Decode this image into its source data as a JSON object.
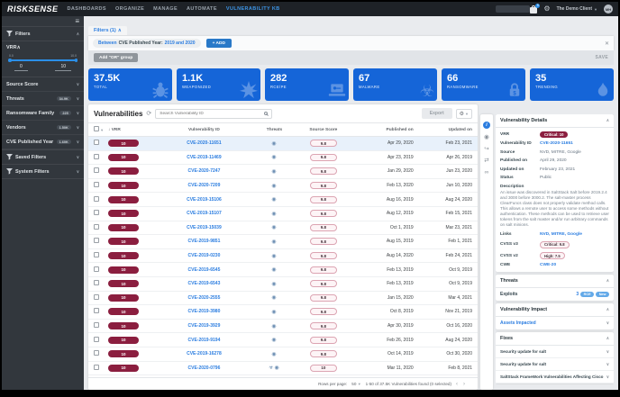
{
  "icon_glyphs": {
    "target-threat-icon": "◉",
    "malware-threat-icon": "☣"
  },
  "nav": {
    "logo": "RISKSENSE",
    "items": [
      {
        "label": "DASHBOARDS"
      },
      {
        "label": "ORGANIZE"
      },
      {
        "label": "MANAGE"
      },
      {
        "label": "AUTOMATE"
      },
      {
        "label": "VULNERABILITY KB",
        "active": true
      }
    ],
    "cart_badge": "5",
    "client": "The Demo Client",
    "avatar": "MH"
  },
  "sidebar": {
    "filters_title": "Filters",
    "vrr": {
      "label": "VRR",
      "min": "0.0",
      "max": "10.0",
      "from": "0",
      "to": "10"
    },
    "facets": [
      {
        "label": "Source Score",
        "count": ""
      },
      {
        "label": "Threats",
        "count": "34.9K"
      },
      {
        "label": "Ransomware Family",
        "count": "225"
      },
      {
        "label": "Vendors",
        "count": "1.50K"
      },
      {
        "label": "CVE Published Year",
        "count": "1.60K"
      }
    ],
    "saved_filters": "Saved Filters",
    "system_filters": "System Filters"
  },
  "filters": {
    "tab": "Filters (1)",
    "chip": {
      "operator": "Between",
      "field": "CVE Published Year:",
      "value": "2019 and 2020"
    },
    "add": "+ ADD",
    "or_group": "Add \"OR\" group",
    "save": "SAVE"
  },
  "stats": [
    {
      "value": "37.5K",
      "label": "TOTAL"
    },
    {
      "value": "1.1K",
      "label": "WEAPONIZED"
    },
    {
      "value": "282",
      "label": "RCE/PE"
    },
    {
      "value": "67",
      "label": "MALWARE"
    },
    {
      "value": "66",
      "label": "RANSOMWARE"
    },
    {
      "value": "35",
      "label": "TRENDING"
    }
  ],
  "table": {
    "title": "Vulnerabilities",
    "search_placeholder": "Search Vulnerability ID",
    "export": "Export",
    "columns": {
      "vrr": "VRR",
      "id": "Vulnerability ID",
      "threats": "Threats",
      "score": "Source Score",
      "published": "Published on",
      "updated": "Updated on"
    },
    "rows": [
      {
        "vrr": "10",
        "id": "CVE-2020-11651",
        "threats": [
          "target-threat-icon"
        ],
        "score": "9.8",
        "published": "Apr 29, 2020",
        "updated": "Feb 23, 2021",
        "selected": true
      },
      {
        "vrr": "10",
        "id": "CVE-2019-11469",
        "threats": [
          "target-threat-icon"
        ],
        "score": "9.8",
        "published": "Apr 23, 2019",
        "updated": "Apr 26, 2019"
      },
      {
        "vrr": "10",
        "id": "CVE-2020-7247",
        "threats": [
          "target-threat-icon"
        ],
        "score": "9.8",
        "published": "Jan 29, 2020",
        "updated": "Jun 23, 2020"
      },
      {
        "vrr": "10",
        "id": "CVE-2020-7209",
        "threats": [
          "target-threat-icon"
        ],
        "score": "9.8",
        "published": "Feb 13, 2020",
        "updated": "Jun 10, 2020"
      },
      {
        "vrr": "10",
        "id": "CVE-2019-15106",
        "threats": [
          "target-threat-icon"
        ],
        "score": "9.8",
        "published": "Aug 16, 2019",
        "updated": "Aug 24, 2020"
      },
      {
        "vrr": "10",
        "id": "CVE-2019-15107",
        "threats": [
          "target-threat-icon"
        ],
        "score": "9.8",
        "published": "Aug 12, 2019",
        "updated": "Feb 15, 2021"
      },
      {
        "vrr": "10",
        "id": "CVE-2019-15039",
        "threats": [
          "target-threat-icon"
        ],
        "score": "9.8",
        "published": "Oct 1, 2019",
        "updated": "Mar 23, 2021"
      },
      {
        "vrr": "10",
        "id": "CVE-2019-9851",
        "threats": [
          "target-threat-icon"
        ],
        "score": "9.8",
        "published": "Aug 15, 2019",
        "updated": "Feb 1, 2021"
      },
      {
        "vrr": "10",
        "id": "CVE-2019-0230",
        "threats": [
          "target-threat-icon"
        ],
        "score": "9.8",
        "published": "Aug 14, 2020",
        "updated": "Feb 24, 2021"
      },
      {
        "vrr": "10",
        "id": "CVE-2019-6545",
        "threats": [
          "target-threat-icon"
        ],
        "score": "9.8",
        "published": "Feb 13, 2019",
        "updated": "Oct 9, 2019"
      },
      {
        "vrr": "10",
        "id": "CVE-2019-6543",
        "threats": [
          "target-threat-icon"
        ],
        "score": "9.8",
        "published": "Feb 13, 2019",
        "updated": "Oct 9, 2019"
      },
      {
        "vrr": "10",
        "id": "CVE-2020-2555",
        "threats": [
          "target-threat-icon"
        ],
        "score": "9.8",
        "published": "Jan 15, 2020",
        "updated": "Mar 4, 2021"
      },
      {
        "vrr": "10",
        "id": "CVE-2019-3980",
        "threats": [
          "target-threat-icon"
        ],
        "score": "9.8",
        "published": "Oct 8, 2019",
        "updated": "Nov 21, 2019"
      },
      {
        "vrr": "10",
        "id": "CVE-2019-3929",
        "threats": [
          "target-threat-icon"
        ],
        "score": "9.8",
        "published": "Apr 30, 2019",
        "updated": "Oct 16, 2020"
      },
      {
        "vrr": "10",
        "id": "CVE-2019-9194",
        "threats": [
          "target-threat-icon"
        ],
        "score": "9.8",
        "published": "Feb 26, 2019",
        "updated": "Aug 24, 2020"
      },
      {
        "vrr": "10",
        "id": "CVE-2019-16278",
        "threats": [
          "target-threat-icon"
        ],
        "score": "9.8",
        "published": "Oct 14, 2019",
        "updated": "Oct 30, 2020"
      },
      {
        "vrr": "10",
        "id": "CVE-2020-0796",
        "threats": [
          "malware-threat-icon",
          "target-threat-icon"
        ],
        "score": "10",
        "published": "Mar 11, 2020",
        "updated": "Feb 8, 2021"
      }
    ],
    "footer": {
      "rows_label": "Rows per page:",
      "rows_value": "50",
      "summary": "1-50 of 37.5K Vulnerabilities found (0 selected)"
    }
  },
  "details": {
    "title": "Vulnerability Details",
    "vrr_label": "VRR",
    "vrr_badge": "Critical: 10",
    "id_label": "Vulnerability ID",
    "id": "CVE-2020-11651",
    "source_label": "Source",
    "source": "NVD, MITRE, Google",
    "published_label": "Published on",
    "published": "April 29, 2020",
    "updated_label": "Updated on",
    "updated": "February 23, 2021",
    "status_label": "Status",
    "status": "Public",
    "description_label": "Description",
    "description": "An issue was discovered in SaltStack Salt before 2019.2.4 and 3000 before 3000.2. The salt-master process ClearFuncs class does not properly validate method calls. This allows a remote user to access some methods without authentication. These methods can be used to retrieve user tokens from the salt master and/or run arbitrary commands on salt minions.",
    "links_label": "Links",
    "links": "NVD, MITRE, Google",
    "cvss3_label": "CVSS v3",
    "cvss3_badge": "Critical: 9.8",
    "cvss2_label": "CVSS v2",
    "cvss2_badge": "High: 7.5",
    "cwe_label": "CWE",
    "cwe": "CWE-20"
  },
  "threats_panel": {
    "title": "Threats",
    "exploits_label": "Exploits",
    "count": "3",
    "badges": [
      "RCE",
      "New"
    ]
  },
  "impact_panel": {
    "title": "Vulnerability Impact",
    "link": "Assets Impacted"
  },
  "fixes_panel": {
    "title": "Fixes",
    "items": [
      "Security update for salt",
      "Security update for salt",
      "SaltStack FrameWork Vulnerabilities Affecting Cisco"
    ]
  }
}
